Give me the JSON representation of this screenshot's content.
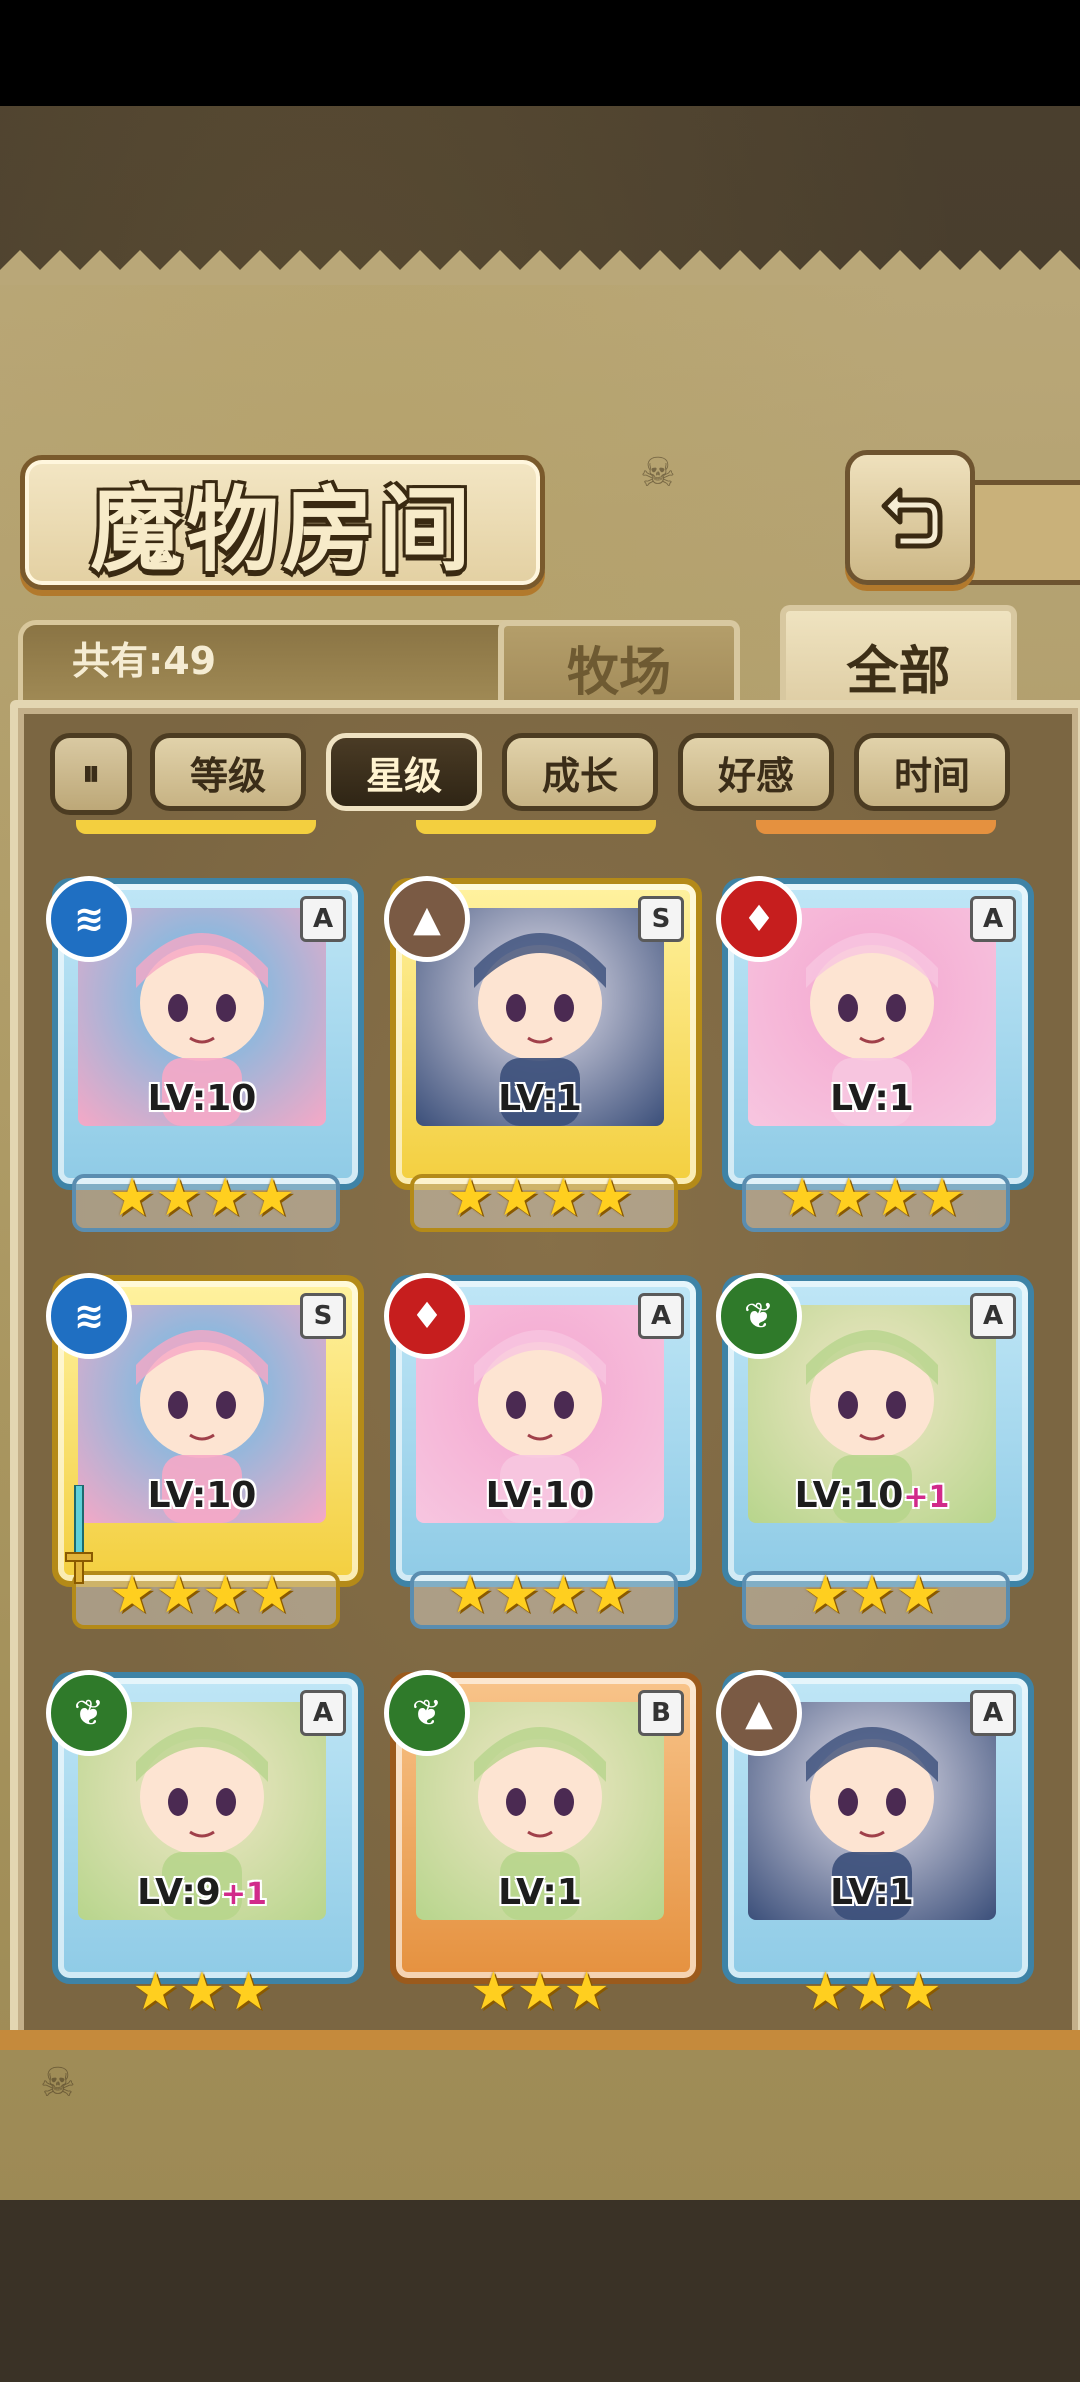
{
  "title": "魔物房间",
  "count_label": "共有:49",
  "tabs": [
    {
      "label": "牧场",
      "active": false
    },
    {
      "label": "全部",
      "active": true
    }
  ],
  "sort": {
    "toggle_label": "⏸",
    "buttons": [
      {
        "label": "等级",
        "active": false
      },
      {
        "label": "星级",
        "active": true
      },
      {
        "label": "成长",
        "active": false
      },
      {
        "label": "好感",
        "active": false
      },
      {
        "label": "时间",
        "active": false
      }
    ]
  },
  "colors": {
    "frame_blue": "#3e83a6",
    "frame_gold": "#b48a18",
    "frame_orange": "#9b5a1c",
    "star": "#ffcf1f",
    "plus": "#d12a8a"
  },
  "monsters": [
    {
      "level": "LV:10",
      "bonus": "",
      "stars": "★★★★",
      "grade": "A",
      "element": "water",
      "element_icon": "water-element-icon",
      "frame": "blue"
    },
    {
      "level": "LV:1",
      "bonus": "",
      "stars": "★★★★",
      "grade": "S",
      "element": "earth",
      "element_icon": "earth-element-icon",
      "frame": "gold"
    },
    {
      "level": "LV:1",
      "bonus": "",
      "stars": "★★★★",
      "grade": "A",
      "element": "fire",
      "element_icon": "fire-element-icon",
      "frame": "blue"
    },
    {
      "level": "LV:10",
      "bonus": "",
      "stars": "★★★★",
      "grade": "S",
      "element": "water",
      "element_icon": "water-element-icon",
      "frame": "gold"
    },
    {
      "level": "LV:10",
      "bonus": "",
      "stars": "★★★★",
      "grade": "A",
      "element": "fire",
      "element_icon": "fire-element-icon",
      "frame": "blue"
    },
    {
      "level": "LV:10",
      "bonus": "+1",
      "stars": "★★★",
      "grade": "A",
      "element": "wood",
      "element_icon": "wood-element-icon",
      "frame": "blue"
    },
    {
      "level": "LV:9",
      "bonus": "+1",
      "stars": "★★★",
      "grade": "A",
      "element": "wood",
      "element_icon": "wood-element-icon",
      "frame": "blue"
    },
    {
      "level": "LV:1",
      "bonus": "",
      "stars": "★★★",
      "grade": "B",
      "element": "wood",
      "element_icon": "wood-element-icon",
      "frame": "orange"
    },
    {
      "level": "LV:1",
      "bonus": "",
      "stars": "★★★",
      "grade": "A",
      "element": "earth",
      "element_icon": "earth-element-icon",
      "frame": "blue"
    }
  ]
}
